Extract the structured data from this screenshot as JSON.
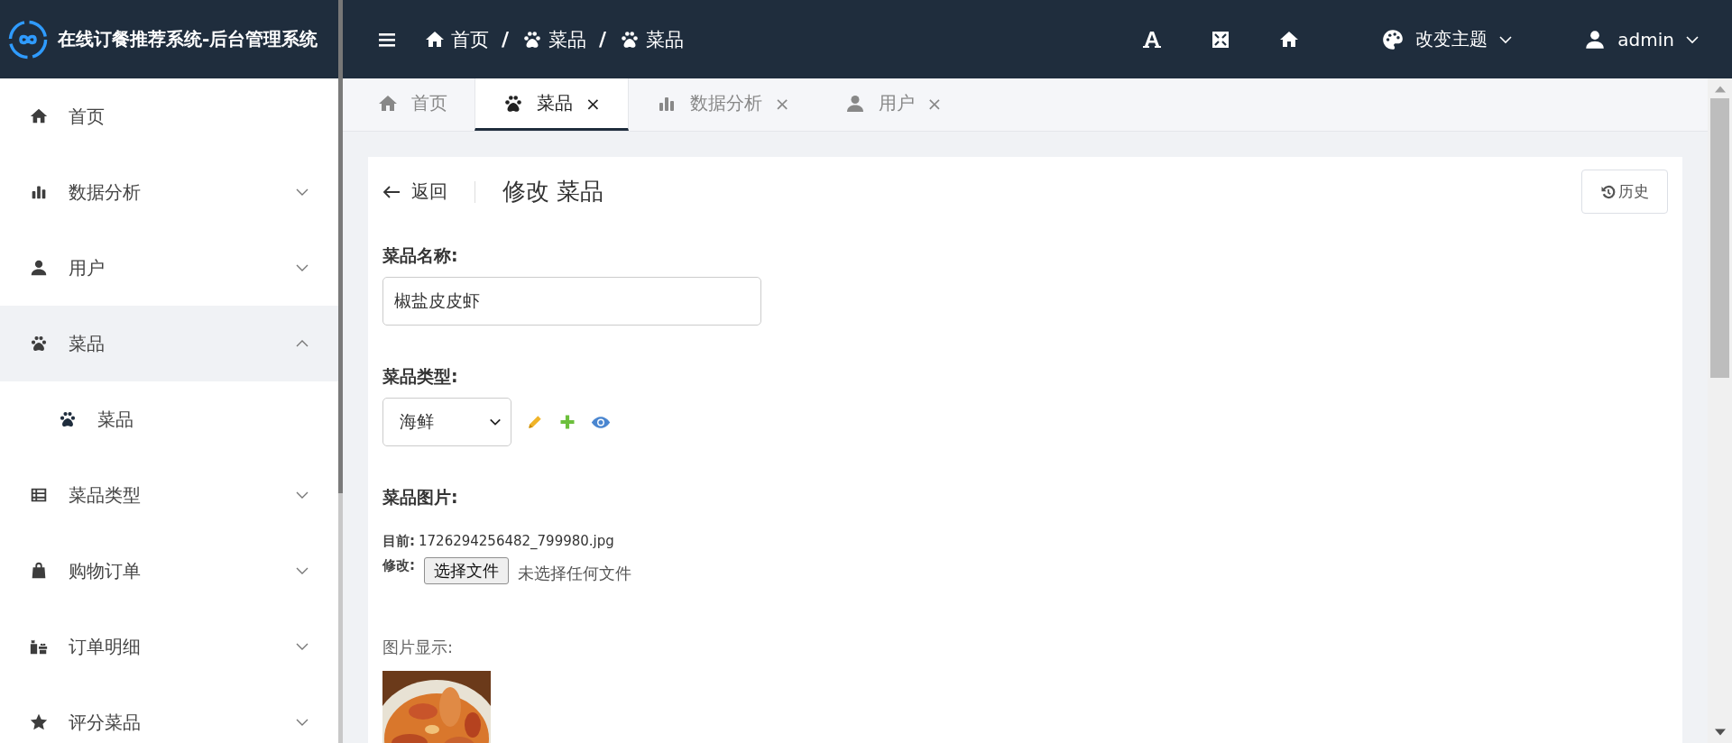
{
  "brand": {
    "title": "在线订餐推荐系统-后台管理系统"
  },
  "breadcrumb": [
    {
      "label": "首页"
    },
    {
      "separator": "/",
      "label": "菜品"
    },
    {
      "separator": "/",
      "label": "菜品"
    }
  ],
  "header": {
    "theme": "改变主题",
    "user": "admin"
  },
  "sidebar": {
    "items": [
      {
        "label": "首页",
        "kind": "link"
      },
      {
        "label": "数据分析",
        "kind": "submenu",
        "expanded": false
      },
      {
        "label": "用户",
        "kind": "submenu",
        "expanded": false
      },
      {
        "label": "菜品",
        "kind": "submenu",
        "expanded": true,
        "children": [
          {
            "label": "菜品"
          }
        ]
      },
      {
        "label": "菜品类型",
        "kind": "submenu",
        "expanded": false
      },
      {
        "label": "购物订单",
        "kind": "submenu",
        "expanded": false
      },
      {
        "label": "订单明细",
        "kind": "submenu",
        "expanded": false
      },
      {
        "label": "评分菜品",
        "kind": "submenu",
        "expanded": false
      }
    ]
  },
  "tabs": [
    {
      "label": "首页",
      "selected": false
    },
    {
      "label": "菜品",
      "selected": true,
      "close": "×"
    },
    {
      "label": "数据分析",
      "selected": false,
      "close": "×"
    },
    {
      "label": "用户",
      "selected": false,
      "close": "×"
    }
  ],
  "page": {
    "back": "返回",
    "title": "修改 菜品",
    "history": "历史"
  },
  "form": {
    "name": {
      "label": "菜品名称:",
      "value": "椒盐皮皮虾"
    },
    "type": {
      "label": "菜品类型:",
      "value": "海鲜"
    },
    "image": {
      "label": "菜品图片:",
      "current_label": "目前:",
      "current_file": "1726294256482_799980.jpg",
      "modify_label": "修改:",
      "file_button": "选择文件",
      "file_status": "未选择任何文件",
      "preview_label": "图片显示:"
    }
  }
}
